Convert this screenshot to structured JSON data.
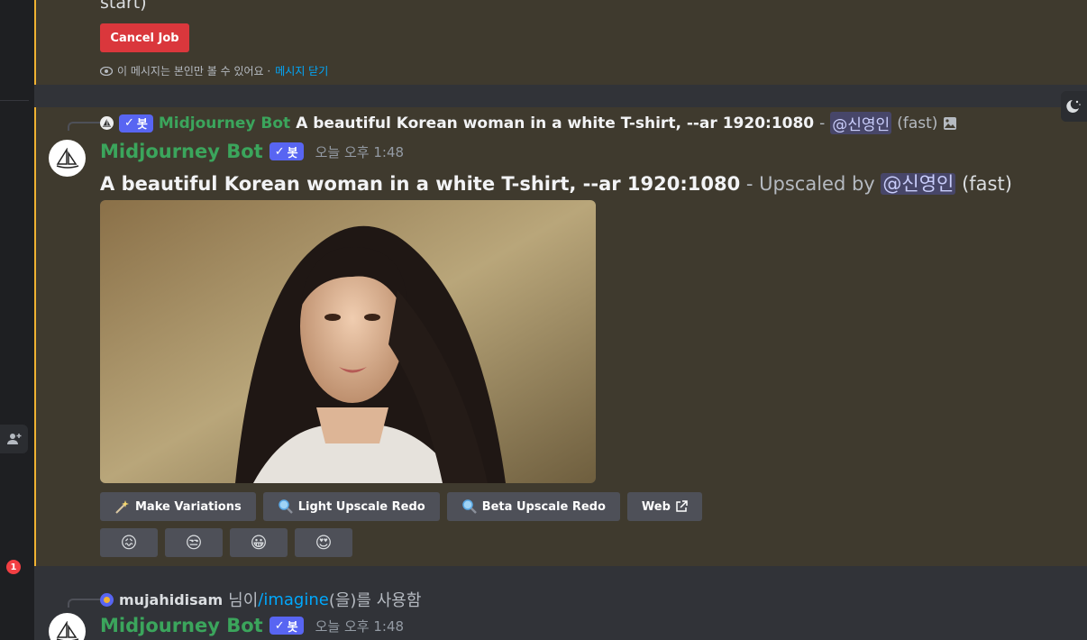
{
  "rail": {
    "notification_count": "1"
  },
  "prev_message": {
    "partial_text": "start)",
    "cancel_button": "Cancel Job",
    "ephemeral_notice": "이 메시지는 본인만 볼 수 있어요 · ",
    "dismiss_link": "메시지 닫기"
  },
  "message": {
    "reply": {
      "username": "Midjourney Bot",
      "badge": "봇",
      "prompt": "A beautiful Korean woman in a white T-shirt, --ar 1920:1080",
      "separator": " - ",
      "mention": "@신영인",
      "mode": "(fast)"
    },
    "author": "Midjourney Bot",
    "badge": "봇",
    "timestamp": "오늘 오후 1:48",
    "prompt": "A beautiful Korean woman in a white T-shirt, --ar 1920:1080",
    "upscaled_by": " - Upscaled by ",
    "mention": "@신영인",
    "mode": "(fast)",
    "buttons": [
      {
        "label": "Make Variations",
        "icon": "magic-wand-icon"
      },
      {
        "label": "Light Upscale Redo",
        "icon": "magnifier-icon"
      },
      {
        "label": "Beta Upscale Redo",
        "icon": "magnifier-icon"
      },
      {
        "label": "Web",
        "icon": "external-link-icon"
      }
    ],
    "reactions": [
      "😖",
      "😒",
      "😀",
      "😍"
    ]
  },
  "next_message": {
    "reply_user": "mujahidisam",
    "reply_suffix_1": " 님이 ",
    "command": "/imagine",
    "reply_suffix_2": "(을)를 사용함",
    "author": "Midjourney Bot",
    "badge": "봇",
    "timestamp": "오늘 오후 1:48"
  },
  "colors": {
    "accent": "#5865f2",
    "bot_name": "#3ba55c",
    "highlight_border": "#f0b232",
    "danger": "#da373c"
  }
}
